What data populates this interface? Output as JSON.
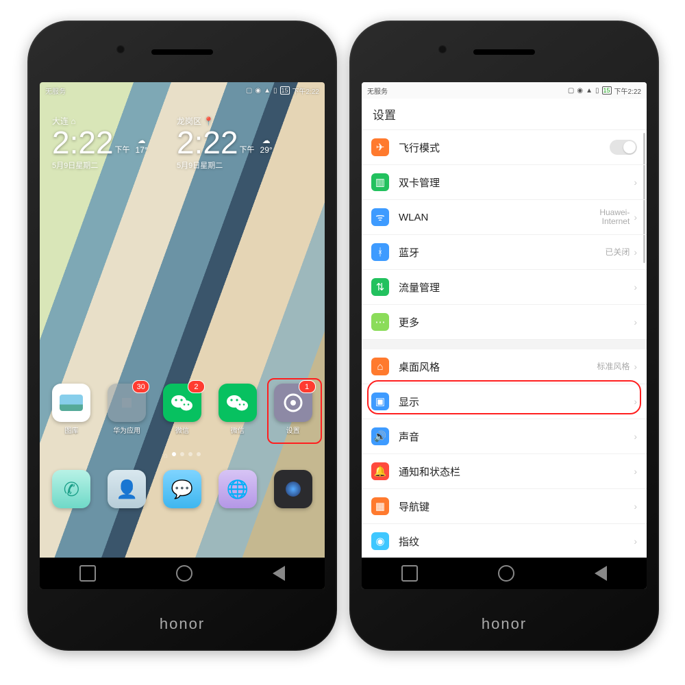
{
  "brand": "honor",
  "status": {
    "carrier": "无服务",
    "battery": "15",
    "time": "下午2:22"
  },
  "home": {
    "loc1": "大连",
    "loc2": "龙岗区",
    "time": "2:22",
    "ampm": "下午",
    "temp1": "17°",
    "temp2": "29°",
    "date1": "5月9日星期二",
    "date2": "5月9日星期二",
    "apps_row1": [
      {
        "label": "图库",
        "badge": null,
        "type": "gallery"
      },
      {
        "label": "华为应用",
        "badge": "30",
        "type": "folder"
      },
      {
        "label": "微信",
        "badge": "2",
        "type": "wechat"
      },
      {
        "label": "微信",
        "badge": null,
        "type": "wechat"
      },
      {
        "label": "设置",
        "badge": "1",
        "type": "settings"
      }
    ],
    "apps_row2": [
      {
        "type": "phone"
      },
      {
        "type": "contacts"
      },
      {
        "type": "messages"
      },
      {
        "type": "browser"
      },
      {
        "type": "camera"
      }
    ]
  },
  "settings": {
    "title": "设置",
    "rows": [
      {
        "icon": "airplane",
        "color": "#ff7a2e",
        "label": "飞行模式",
        "toggle": true
      },
      {
        "icon": "sim",
        "color": "#22c15e",
        "label": "双卡管理"
      },
      {
        "icon": "wifi",
        "color": "#3e9bff",
        "label": "WLAN",
        "value": "Huawei-\nInternet"
      },
      {
        "icon": "bt",
        "color": "#3e9bff",
        "label": "蓝牙",
        "value": "已关闭"
      },
      {
        "icon": "data",
        "color": "#22c15e",
        "label": "流量管理"
      },
      {
        "icon": "more",
        "color": "#8bdc5a",
        "label": "更多"
      },
      {
        "gap": true
      },
      {
        "icon": "home",
        "color": "#ff7a2e",
        "label": "桌面风格",
        "value": "标准风格"
      },
      {
        "icon": "display",
        "color": "#3e9bff",
        "label": "显示",
        "highlight": true
      },
      {
        "icon": "sound",
        "color": "#3e9bff",
        "label": "声音"
      },
      {
        "icon": "notif",
        "color": "#ff4a3d",
        "label": "通知和状态栏"
      },
      {
        "icon": "navkey",
        "color": "#ff7a2e",
        "label": "导航键"
      },
      {
        "icon": "finger",
        "color": "#3ec7ff",
        "label": "指纹"
      }
    ]
  }
}
